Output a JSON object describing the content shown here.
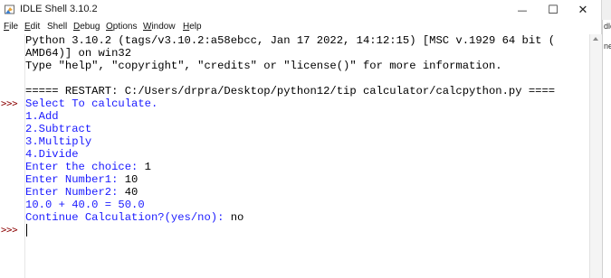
{
  "window": {
    "title": "IDLE Shell 3.10.2",
    "minimize_glyph": "—",
    "maximize_glyph": "☐",
    "close_glyph": "✕"
  },
  "menu": [
    {
      "label": "File",
      "mnemonic": "F",
      "rest": "ile"
    },
    {
      "label": "Edit",
      "mnemonic": "E",
      "rest": "dit"
    },
    {
      "label": "Shell",
      "mnemonic": "",
      "rest": "Shell"
    },
    {
      "label": "Debug",
      "mnemonic": "D",
      "rest": "ebug"
    },
    {
      "label": "Options",
      "mnemonic": "O",
      "rest": "ptions"
    },
    {
      "label": "Window",
      "mnemonic": "W",
      "rest": "indow"
    },
    {
      "label": "Help",
      "mnemonic": "H",
      "rest": "elp"
    }
  ],
  "prompts": [
    ">>>",
    ">>>"
  ],
  "shell_lines": [
    {
      "text": "Python 3.10.2 (tags/v3.10.2:a58ebcc, Jan 17 2022, 14:12:15) [MSC v.1929 64 bit (",
      "kind": "out"
    },
    {
      "text": "AMD64)] on win32",
      "kind": "out"
    },
    {
      "text": "Type \"help\", \"copyright\", \"credits\" or \"license()\" for more information.",
      "kind": "out"
    },
    {
      "text": "",
      "kind": "out"
    },
    {
      "text": "===== RESTART: C:/Users/drpra/Desktop/python12/tip calculator/calcpython.py ====",
      "kind": "in"
    },
    {
      "text": "Select To calculate.",
      "kind": "std"
    },
    {
      "text": "1.Add",
      "kind": "std"
    },
    {
      "text": "2.Subtract",
      "kind": "std"
    },
    {
      "text": "3.Multiply",
      "kind": "std"
    },
    {
      "text": "4.Divide",
      "kind": "std"
    },
    {
      "text": "Enter the choice: ",
      "input": "1",
      "kind": "mixed"
    },
    {
      "text": "Enter Number1: ",
      "input": "10",
      "kind": "mixed"
    },
    {
      "text": "Enter Number2: ",
      "input": "40",
      "kind": "mixed"
    },
    {
      "text": "10.0 + 40.0 = 50.0",
      "kind": "std"
    },
    {
      "text": "Continue Calculation?(yes/no): ",
      "input": "no",
      "kind": "mixed"
    }
  ],
  "background_window": {
    "text1": "dle",
    "text2": "ne"
  },
  "colors": {
    "stdout": "#1a1aff",
    "prompt": "#8b0000",
    "output": "#000000"
  }
}
